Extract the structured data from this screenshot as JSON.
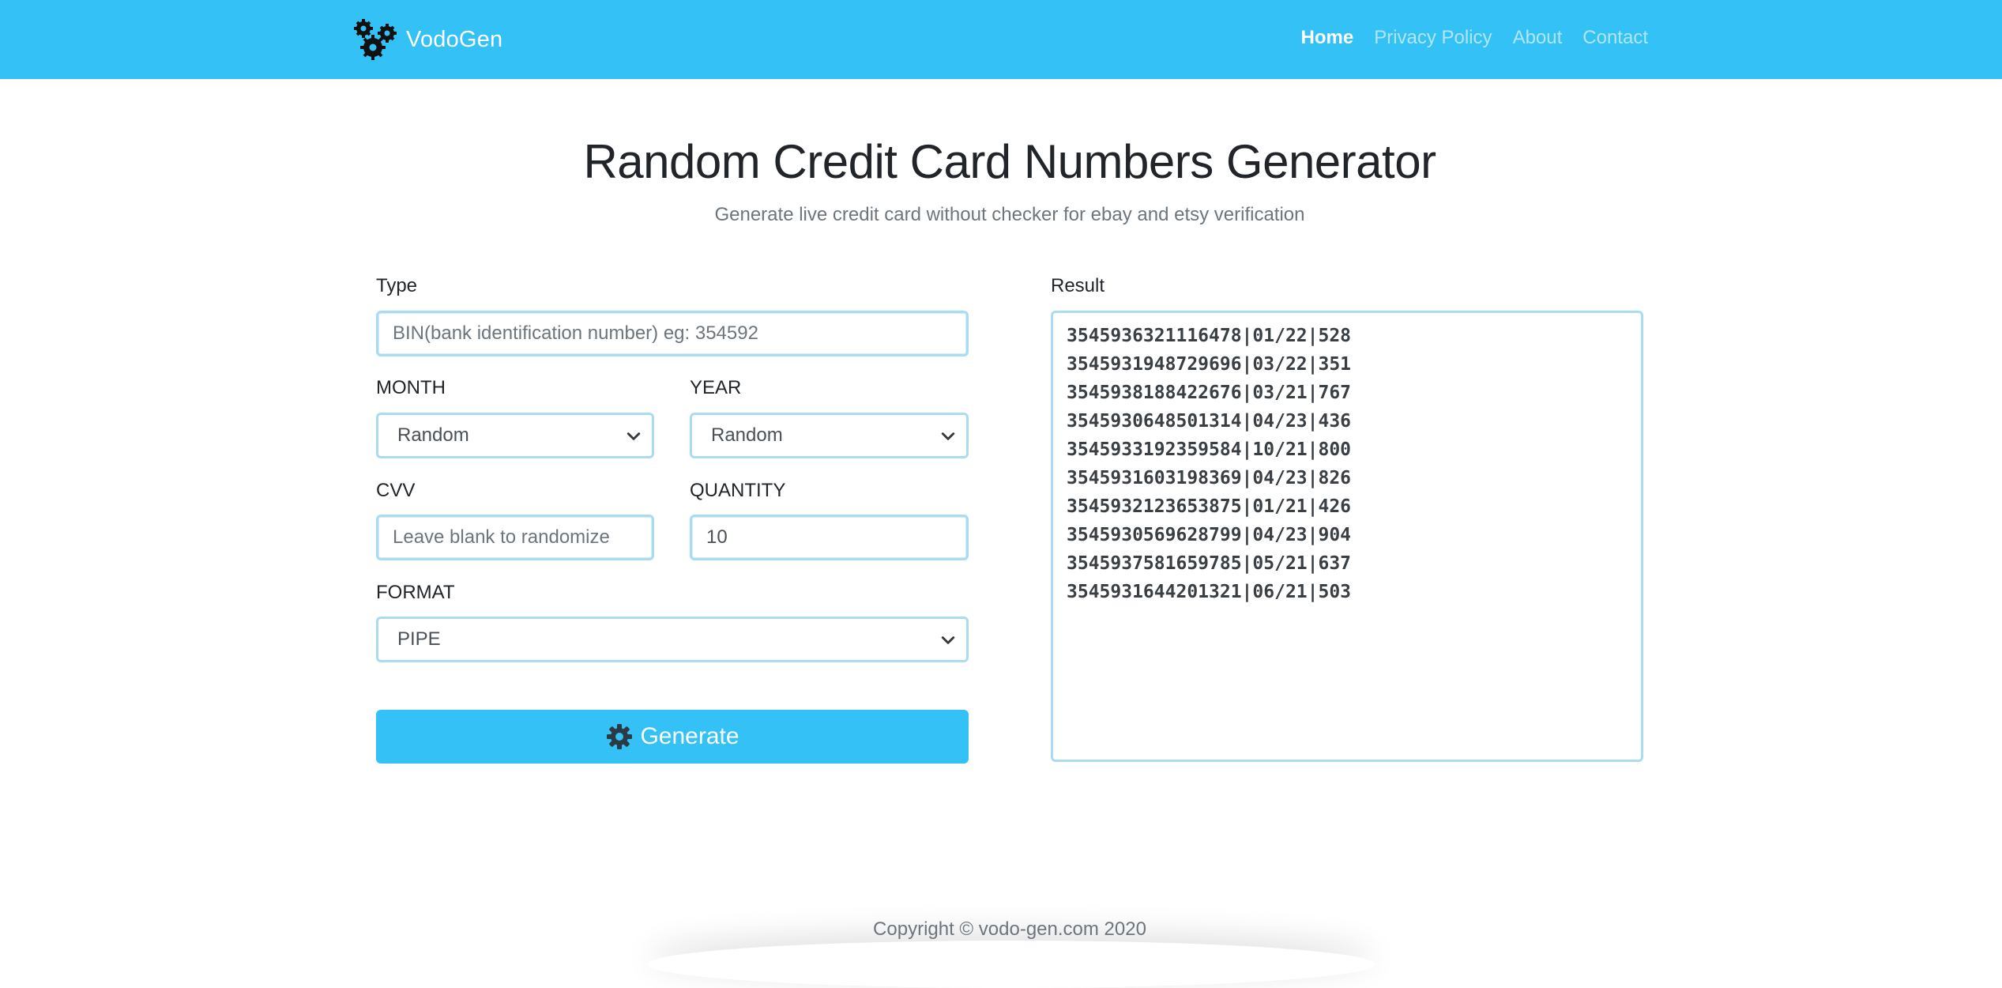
{
  "navbar": {
    "brand": "VodoGen",
    "links": [
      {
        "label": "Home"
      },
      {
        "label": "Privacy Policy"
      },
      {
        "label": "About"
      },
      {
        "label": "Contact"
      }
    ],
    "active": "Home",
    "bg_color": "#33c1f6"
  },
  "header": {
    "title": "Random Credit Card Numbers Generator",
    "subtitle": "Generate live credit card without checker for ebay and etsy verification"
  },
  "form": {
    "type": {
      "label": "Type",
      "value": "",
      "placeholder": "BIN(bank identification number) eg: 354592"
    },
    "month": {
      "label": "MONTH",
      "value": "Random"
    },
    "year": {
      "label": "YEAR",
      "value": "Random"
    },
    "cvv": {
      "label": "CVV",
      "value": "",
      "placeholder": "Leave blank to randomize"
    },
    "quantity": {
      "label": "QUANTITY",
      "value": "10"
    },
    "format": {
      "label": "FORMAT",
      "value": "PIPE"
    },
    "generate_label": "Generate"
  },
  "result": {
    "label": "Result",
    "lines": [
      "3545936321116478|01/22|528",
      "3545931948729696|03/22|351",
      "3545938188422676|03/21|767",
      "3545930648501314|04/23|436",
      "3545933192359584|10/21|800",
      "3545931603198369|04/23|826",
      "3545932123653875|01/21|426",
      "3545930569628799|04/23|904",
      "3545937581659785|05/21|637",
      "3545931644201321|06/21|503"
    ]
  },
  "footer": {
    "text": "Copyright © vodo-gen.com 2020"
  },
  "icons": {
    "brand_logo": "gears-icon",
    "generate": "gear-icon",
    "select_arrow": "chevron-down-icon"
  }
}
